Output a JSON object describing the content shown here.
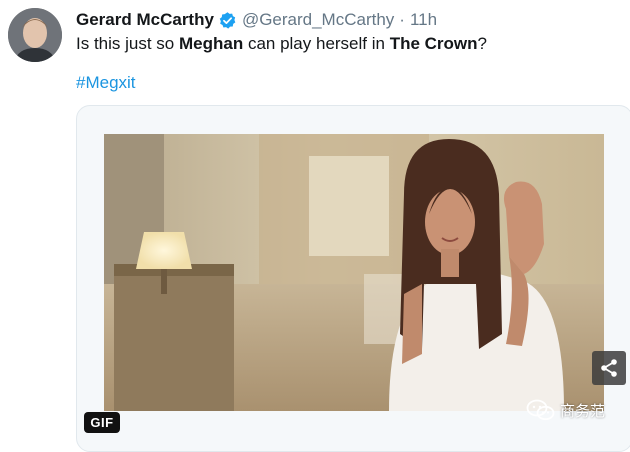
{
  "tweet": {
    "display_name": "Gerard McCarthy",
    "verified_icon": "verified-badge-icon",
    "handle": "@Gerard_McCarthy",
    "separator": "·",
    "time": "11h",
    "text_parts": [
      "Is this just so ",
      "Meghan",
      " can play herself in ",
      "The Crown",
      "?"
    ],
    "hashtag": "#Megxit"
  },
  "media": {
    "type_badge": "GIF",
    "share_icon": "share-icon"
  },
  "watermark": {
    "text": "商务范",
    "icon": "wechat-icon"
  },
  "colors": {
    "link": "#1b95e0",
    "verified": "#1da1f2",
    "secondary_text": "#657786",
    "card_border": "#e1e8ed"
  }
}
